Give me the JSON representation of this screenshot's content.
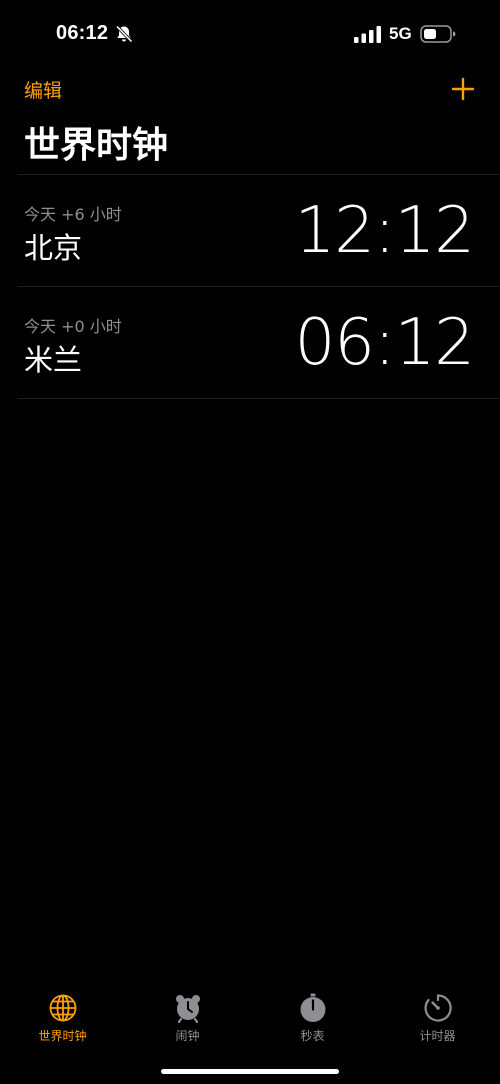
{
  "status_bar": {
    "time": "06:12",
    "network": "5G",
    "icons": [
      "bell-slash-icon",
      "cellular-signal-icon",
      "battery-icon"
    ]
  },
  "nav": {
    "edit_label": "编辑",
    "add_icon": "plus-icon"
  },
  "title": "世界时钟",
  "clocks": [
    {
      "offset": "今天 +6 小时",
      "city": "北京",
      "time": "12:12"
    },
    {
      "offset": "今天 +0 小时",
      "city": "米兰",
      "time": "06:12"
    }
  ],
  "tabs": [
    {
      "label": "世界时钟",
      "icon": "globe-icon",
      "active": true
    },
    {
      "label": "闹钟",
      "icon": "alarm-clock-icon",
      "active": false
    },
    {
      "label": "秒表",
      "icon": "stopwatch-icon",
      "active": false
    },
    {
      "label": "计时器",
      "icon": "timer-icon",
      "active": false
    }
  ],
  "colors": {
    "accent": "#ff9f0a",
    "background": "#000000",
    "secondary_text": "#8e8e93",
    "separator": "#1f1f1f"
  }
}
